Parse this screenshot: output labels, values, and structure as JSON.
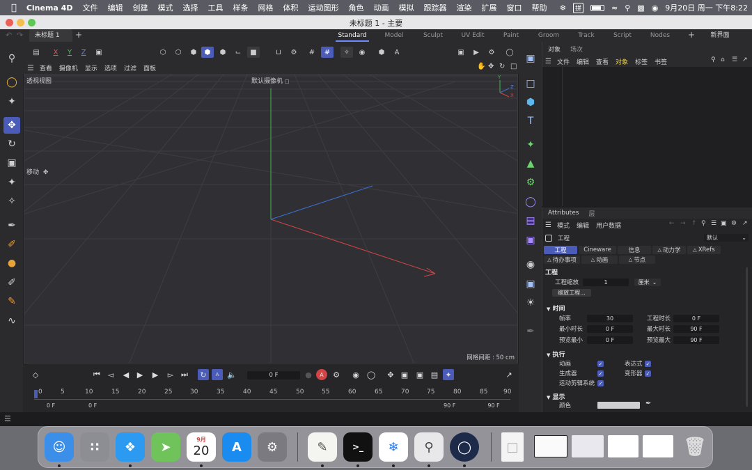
{
  "menubar": {
    "app": "Cinema 4D",
    "items": [
      "文件",
      "编辑",
      "创建",
      "模式",
      "选择",
      "工具",
      "样条",
      "网格",
      "体积",
      "运动图形",
      "角色",
      "动画",
      "模拟",
      "跟踪器",
      "渲染",
      "扩展",
      "窗口",
      "帮助"
    ],
    "datetime": "9月20日 周一 下午8:22"
  },
  "window": {
    "title": "未标题 1 - 主要"
  },
  "tabs": {
    "doc_tab": "未标题 1",
    "layouts": [
      "Standard",
      "Model",
      "Sculpt",
      "UV Edit",
      "Paint",
      "Groom",
      "Track",
      "Script",
      "Nodes"
    ],
    "active_layout": "Standard",
    "new_interface": "新界面"
  },
  "viewport": {
    "menu": [
      "查看",
      "摄像机",
      "显示",
      "选项",
      "过滤",
      "面板"
    ],
    "view_name": "透视视图",
    "camera": "默认摄像机",
    "tool_label": "移动",
    "grid_spacing": "网格间距 : 50 cm",
    "axis_x": "X",
    "axis_y": "Y",
    "axis_z": "Z"
  },
  "toolbar_axes": [
    "X",
    "Y",
    "Z"
  ],
  "timeline": {
    "frame": "0 F",
    "ticks": [
      "0",
      "5",
      "10",
      "15",
      "20",
      "25",
      "30",
      "35",
      "40",
      "45",
      "50",
      "55",
      "60",
      "65",
      "70",
      "75",
      "80",
      "85",
      "90"
    ],
    "start": "0 F",
    "range_start": "0 F",
    "range_end": "90 F",
    "end": "90 F"
  },
  "objects": {
    "tabs": [
      "对象",
      "场次"
    ],
    "menu": [
      "文件",
      "编辑",
      "查看",
      "对象",
      "标签",
      "书签"
    ],
    "active_menu": "对象"
  },
  "attributes": {
    "tabs": [
      "Attributes",
      "层"
    ],
    "menu": [
      "模式",
      "编辑",
      "用户数据"
    ],
    "object": "工程",
    "preset": "默认",
    "subtabs": [
      "工程",
      "Cineware",
      "信息",
      "动力学",
      "XRefs"
    ],
    "subtabs2": [
      "待办事项",
      "动画",
      "节点"
    ],
    "section_project": "工程",
    "scale_label": "工程缩放",
    "scale_value": "1",
    "scale_unit": "厘米",
    "scale_button": "缩放工程...",
    "section_time": "时间",
    "fps_label": "帧率",
    "fps_value": "30",
    "duration_label": "工程时长",
    "duration_value": "0 F",
    "min_label": "最小时长",
    "min_value": "0 F",
    "max_label": "最大时长",
    "max_value": "90 F",
    "pmin_label": "预览最小",
    "pmin_value": "0 F",
    "pmax_label": "预览最大",
    "pmax_value": "90 F",
    "section_exec": "执行",
    "anim_label": "动画",
    "expr_label": "表达式",
    "gen_label": "生成器",
    "deform_label": "变形器",
    "mograph_label": "运动剪辑系统",
    "section_display": "显示",
    "color_label": "颜色"
  },
  "dock": {
    "calendar_month": "9月",
    "calendar_day": "20"
  },
  "colors": {
    "accent": "#4a5cb8",
    "x_axis": "#d04545",
    "y_axis": "#3fb64f",
    "z_axis": "#3d6fd6"
  }
}
